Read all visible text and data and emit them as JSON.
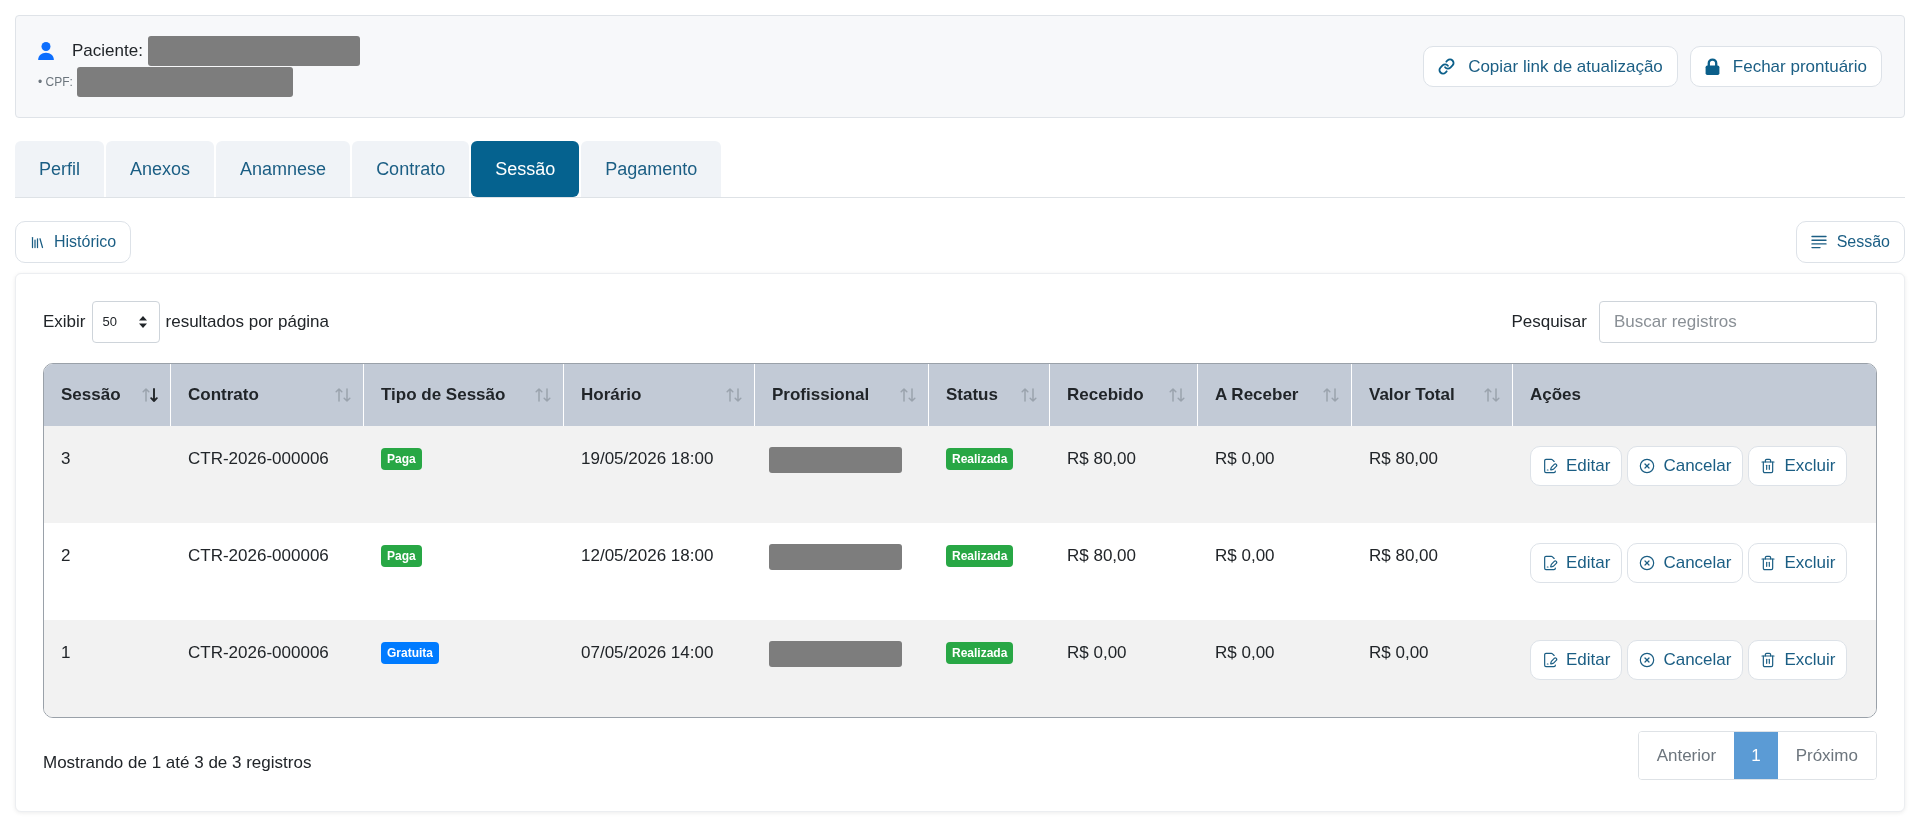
{
  "patient": {
    "label": "Paciente:",
    "cpf_label": "• CPF:"
  },
  "header_actions": [
    "Copiar link de atualização",
    "Fechar prontuário"
  ],
  "tabs": [
    {
      "label": "Perfil",
      "selected": false
    },
    {
      "label": "Anexos",
      "selected": false
    },
    {
      "label": "Anamnese",
      "selected": false
    },
    {
      "label": "Contrato",
      "selected": false
    },
    {
      "label": "Sessão",
      "selected": true
    },
    {
      "label": "Pagamento",
      "selected": false
    }
  ],
  "toolbar": {
    "history_button": "Histórico",
    "session_button": "Sessão"
  },
  "page_size": {
    "prefix": "Exibir",
    "value": "50",
    "suffix": "resultados por página"
  },
  "search": {
    "label": "Pesquisar",
    "placeholder": "Buscar registros"
  },
  "table": {
    "columns": [
      {
        "label": "Sessão",
        "sortable": true,
        "sorted": true
      },
      {
        "label": "Contrato",
        "sortable": true,
        "sorted": false
      },
      {
        "label": "Tipo de Sessão",
        "sortable": true,
        "sorted": false
      },
      {
        "label": "Horário",
        "sortable": true,
        "sorted": false
      },
      {
        "label": "Profissional",
        "sortable": true,
        "sorted": false
      },
      {
        "label": "Status",
        "sortable": true,
        "sorted": false
      },
      {
        "label": "Recebido",
        "sortable": true,
        "sorted": false
      },
      {
        "label": "A Receber",
        "sortable": true,
        "sorted": false
      },
      {
        "label": "Valor Total",
        "sortable": true,
        "sorted": false
      },
      {
        "label": "Ações",
        "sortable": false
      }
    ],
    "rows": [
      {
        "session": "3",
        "contract": "CTR-2026-000006",
        "type": {
          "label": "Paga",
          "color": "#28a745"
        },
        "time": "19/05/2026 18:00",
        "status": "Realizada",
        "received": "R$ 80,00",
        "to_receive": "R$ 0,00",
        "total": "R$ 80,00",
        "actions": [
          "Editar",
          "Cancelar",
          "Excluir"
        ]
      },
      {
        "session": "2",
        "contract": "CTR-2026-000006",
        "type": {
          "label": "Paga",
          "color": "#28a745"
        },
        "time": "12/05/2026 18:00",
        "status": "Realizada",
        "received": "R$ 80,00",
        "to_receive": "R$ 0,00",
        "total": "R$ 80,00",
        "actions": [
          "Editar",
          "Cancelar",
          "Excluir"
        ]
      },
      {
        "session": "1",
        "contract": "CTR-2026-000006",
        "type": {
          "label": "Gratuita",
          "color": "#007bff"
        },
        "time": "07/05/2026 14:00",
        "status": "Realizada",
        "received": "R$ 0,00",
        "to_receive": "R$ 0,00",
        "total": "R$ 0,00",
        "actions": [
          "Editar",
          "Cancelar",
          "Excluir"
        ]
      }
    ]
  },
  "info": "Mostrando de 1 até 3 de 3 registros",
  "pagination": [
    {
      "label": "Anterior",
      "selected": false
    },
    {
      "label": "1",
      "selected": true
    },
    {
      "label": "Próximo",
      "selected": false
    }
  ]
}
